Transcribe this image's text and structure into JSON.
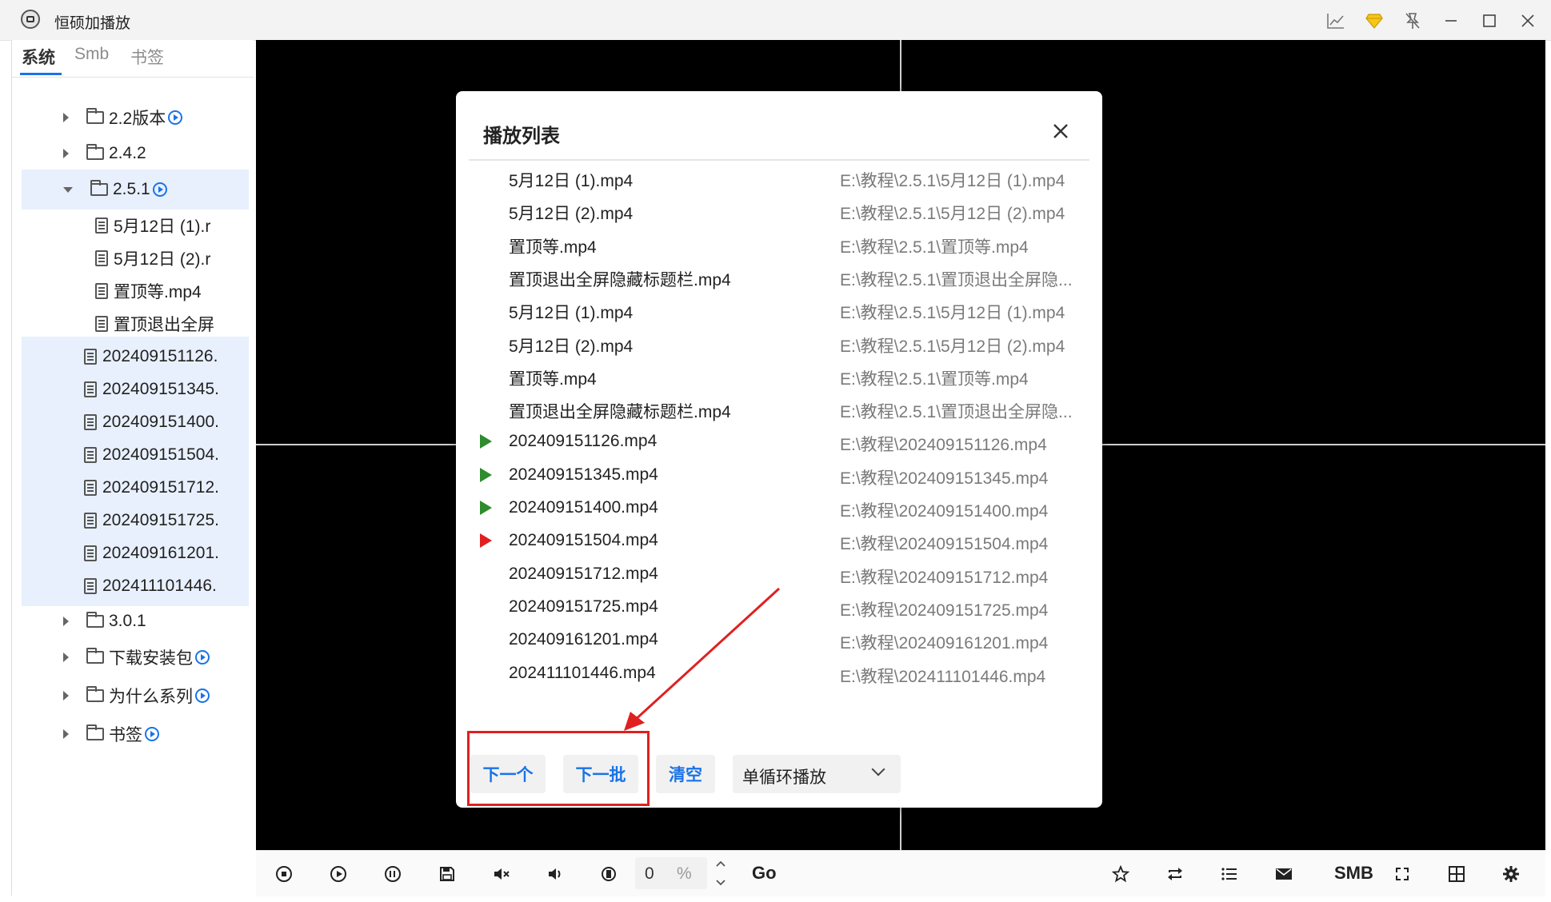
{
  "app": {
    "title": "恒硕加播放"
  },
  "sidebar": {
    "tabs": [
      "系统",
      "Smb",
      "书签"
    ],
    "active_tab": "系统",
    "tree": [
      {
        "label": "2.2版本",
        "type": "folder",
        "expanded": false,
        "playable": true
      },
      {
        "label": "2.4.2",
        "type": "folder",
        "expanded": false,
        "playable": false
      },
      {
        "label": "2.5.1",
        "type": "folder",
        "expanded": true,
        "playable": true,
        "selected": true
      },
      {
        "label": "5月12日 (1).r",
        "type": "file"
      },
      {
        "label": "5月12日 (2).r",
        "type": "file"
      },
      {
        "label": "置顶等.mp4",
        "type": "file"
      },
      {
        "label": "置顶退出全屏",
        "type": "file"
      },
      {
        "label": "202409151126.",
        "type": "file",
        "selected": true
      },
      {
        "label": "202409151345.",
        "type": "file",
        "selected": true
      },
      {
        "label": "202409151400.",
        "type": "file",
        "selected": true
      },
      {
        "label": "202409151504.",
        "type": "file",
        "selected": true
      },
      {
        "label": "202409151712.",
        "type": "file",
        "selected": true
      },
      {
        "label": "202409151725.",
        "type": "file",
        "selected": true
      },
      {
        "label": "202409161201.",
        "type": "file",
        "selected": true
      },
      {
        "label": "202411101446.",
        "type": "file",
        "selected": true
      },
      {
        "label": "3.0.1",
        "type": "folder",
        "expanded": false,
        "playable": false
      },
      {
        "label": "下载安装包",
        "type": "folder",
        "expanded": false,
        "playable": true
      },
      {
        "label": "为什么系列",
        "type": "folder",
        "expanded": false,
        "playable": true
      },
      {
        "label": "书签",
        "type": "folder",
        "expanded": false,
        "playable": true
      }
    ]
  },
  "dialog": {
    "title": "播放列表",
    "items": [
      {
        "name": "5月12日 (1).mp4",
        "path": "E:\\教程\\2.5.1\\5月12日 (1).mp4",
        "marker": ""
      },
      {
        "name": "5月12日 (2).mp4",
        "path": "E:\\教程\\2.5.1\\5月12日 (2).mp4",
        "marker": ""
      },
      {
        "name": "置顶等.mp4",
        "path": "E:\\教程\\2.5.1\\置顶等.mp4",
        "marker": ""
      },
      {
        "name": "置顶退出全屏隐藏标题栏.mp4",
        "path": "E:\\教程\\2.5.1\\置顶退出全屏隐...",
        "marker": ""
      },
      {
        "name": "5月12日 (1).mp4",
        "path": "E:\\教程\\2.5.1\\5月12日 (1).mp4",
        "marker": ""
      },
      {
        "name": "5月12日 (2).mp4",
        "path": "E:\\教程\\2.5.1\\5月12日 (2).mp4",
        "marker": ""
      },
      {
        "name": "置顶等.mp4",
        "path": "E:\\教程\\2.5.1\\置顶等.mp4",
        "marker": ""
      },
      {
        "name": "置顶退出全屏隐藏标题栏.mp4",
        "path": "E:\\教程\\2.5.1\\置顶退出全屏隐...",
        "marker": ""
      },
      {
        "name": "202409151126.mp4",
        "path": "E:\\教程\\202409151126.mp4",
        "marker": "green"
      },
      {
        "name": "202409151345.mp4",
        "path": "E:\\教程\\202409151345.mp4",
        "marker": "green"
      },
      {
        "name": "202409151400.mp4",
        "path": "E:\\教程\\202409151400.mp4",
        "marker": "green"
      },
      {
        "name": "202409151504.mp4",
        "path": "E:\\教程\\202409151504.mp4",
        "marker": "red"
      },
      {
        "name": "202409151712.mp4",
        "path": "E:\\教程\\202409151712.mp4",
        "marker": ""
      },
      {
        "name": "202409151725.mp4",
        "path": "E:\\教程\\202409151725.mp4",
        "marker": ""
      },
      {
        "name": "202409161201.mp4",
        "path": "E:\\教程\\202409161201.mp4",
        "marker": ""
      },
      {
        "name": "202411101446.mp4",
        "path": "E:\\教程\\202411101446.mp4",
        "marker": ""
      }
    ],
    "buttons": {
      "next": "下一个",
      "next_batch": "下一批",
      "clear": "清空"
    },
    "mode_select": "单循环播放"
  },
  "toolbar": {
    "volume_value": "0",
    "volume_unit": "%",
    "go_label": "Go",
    "smb_label": "SMB"
  },
  "colors": {
    "accent": "#1a73e8",
    "playing_marker": "#2e8b2e",
    "current_marker": "#e02020",
    "annotation": "#e02020",
    "video_bg": "#000000"
  }
}
